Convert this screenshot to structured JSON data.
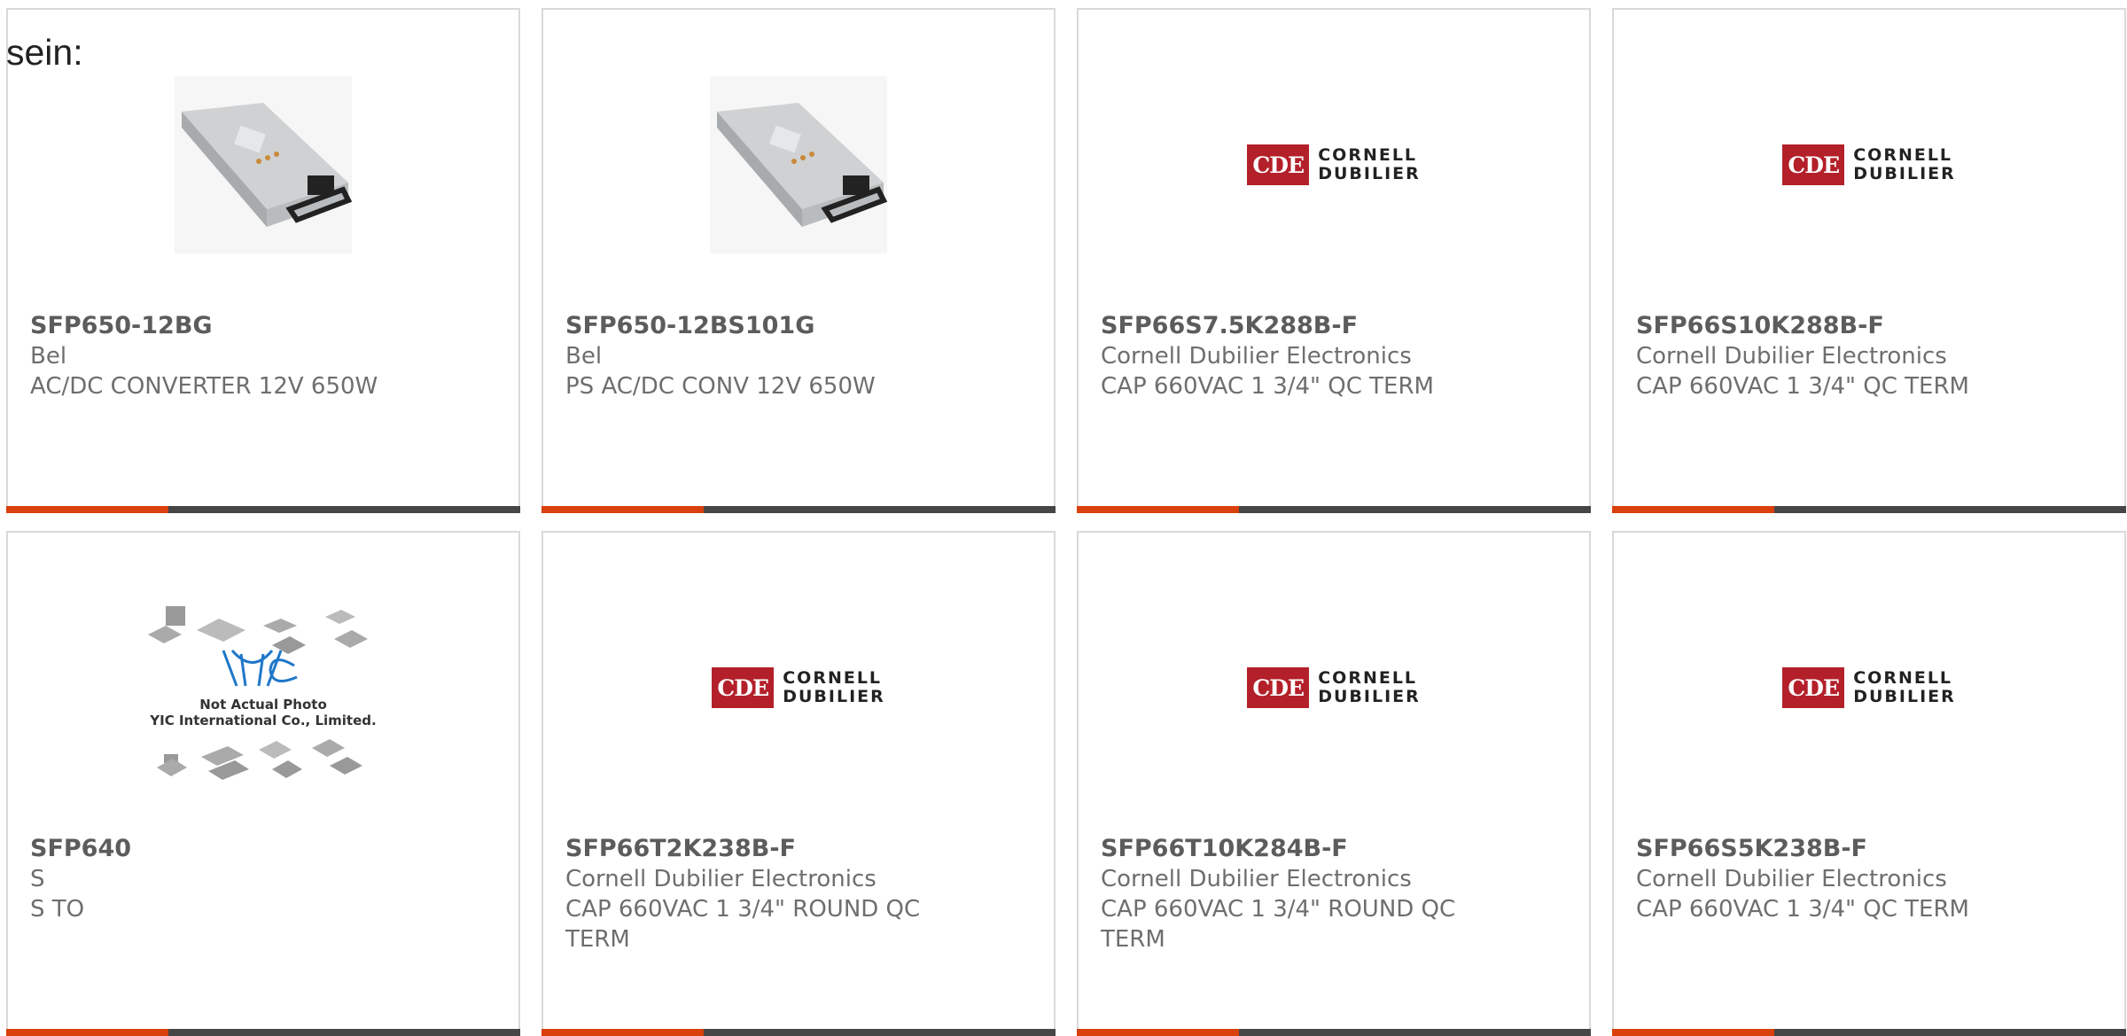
{
  "lead_text": "sein:",
  "products": [
    {
      "part_number": "SFP650-12BG",
      "manufacturer": "Bel",
      "description": "AC/DC CONVERTER 12V 650W",
      "image": "power-supply-photo"
    },
    {
      "part_number": "SFP650-12BS101G",
      "manufacturer": "Bel",
      "description": "PS AC/DC CONV 12V 650W",
      "image": "power-supply-photo"
    },
    {
      "part_number": "SFP66S7.5K288B-F",
      "manufacturer": "Cornell Dubilier Electronics",
      "description": "CAP 660VAC 1 3/4\" QC TERM",
      "image": "cde-logo"
    },
    {
      "part_number": "SFP66S10K288B-F",
      "manufacturer": "Cornell Dubilier Electronics",
      "description": "CAP 660VAC 1 3/4\" QC TERM",
      "image": "cde-logo"
    },
    {
      "part_number": "SFP640",
      "manufacturer": "S",
      "description": "S TO",
      "image": "yic-placeholder"
    },
    {
      "part_number": "SFP66T2K238B-F",
      "manufacturer": "Cornell Dubilier Electronics",
      "description": "CAP 660VAC 1 3/4\" ROUND QC TERM",
      "image": "cde-logo"
    },
    {
      "part_number": "SFP66T10K284B-F",
      "manufacturer": "Cornell Dubilier Electronics",
      "description": "CAP 660VAC 1 3/4\" ROUND QC TERM",
      "image": "cde-logo"
    },
    {
      "part_number": "SFP66S5K238B-F",
      "manufacturer": "Cornell Dubilier Electronics",
      "description": "CAP 660VAC 1 3/4\" QC TERM",
      "image": "cde-logo"
    }
  ],
  "logo": {
    "cde_box": "CDE",
    "cde_line1": "CORNELL",
    "cde_line2": "DUBILIER"
  },
  "placeholder": {
    "line1": "Not Actual Photo",
    "line2": "YIC International Co., Limited."
  },
  "colors": {
    "accent": "#d9400b",
    "bar": "#464646",
    "cde_red": "#b3202a"
  }
}
